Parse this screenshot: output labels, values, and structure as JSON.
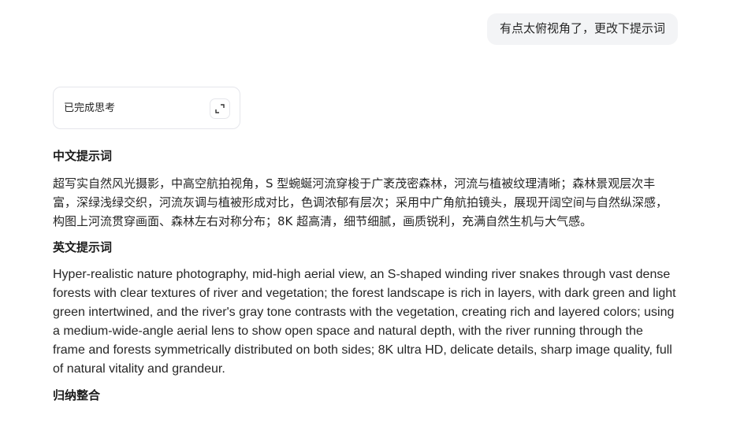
{
  "user_message": "有点太俯视角了，更改下提示词",
  "thinking": {
    "label": "已完成思考",
    "expand_icon": "expand-icon"
  },
  "sections": {
    "zh": {
      "heading": "中文提示词",
      "text": "超写实自然风光摄影，中高空航拍视角，S 型蜿蜒河流穿梭于广袤茂密森林，河流与植被纹理清晰；森林景观层次丰富，深绿浅绿交织，河流灰调与植被形成对比，色调浓郁有层次；采用中广角航拍镜头，展现开阔空间与自然纵深感，构图上河流贯穿画面、森林左右对称分布；8K 超高清，细节细腻，画质锐利，充满自然生机与大气感。"
    },
    "en": {
      "heading": "英文提示词",
      "text": "Hyper-realistic nature photography, mid-high aerial view, an S-shaped winding river snakes through vast dense forests with clear textures of river and vegetation; the forest landscape is rich in layers, with dark green and light green intertwined, and the river's gray tone contrasts with the vegetation, creating rich and layered colors; using a medium-wide-angle aerial lens to show open space and natural depth, with the river running through the frame and forests symmetrically distributed on both sides; 8K ultra HD, delicate details, sharp image quality, full of natural vitality and grandeur."
    },
    "summary": {
      "heading": "归纳整合"
    }
  }
}
